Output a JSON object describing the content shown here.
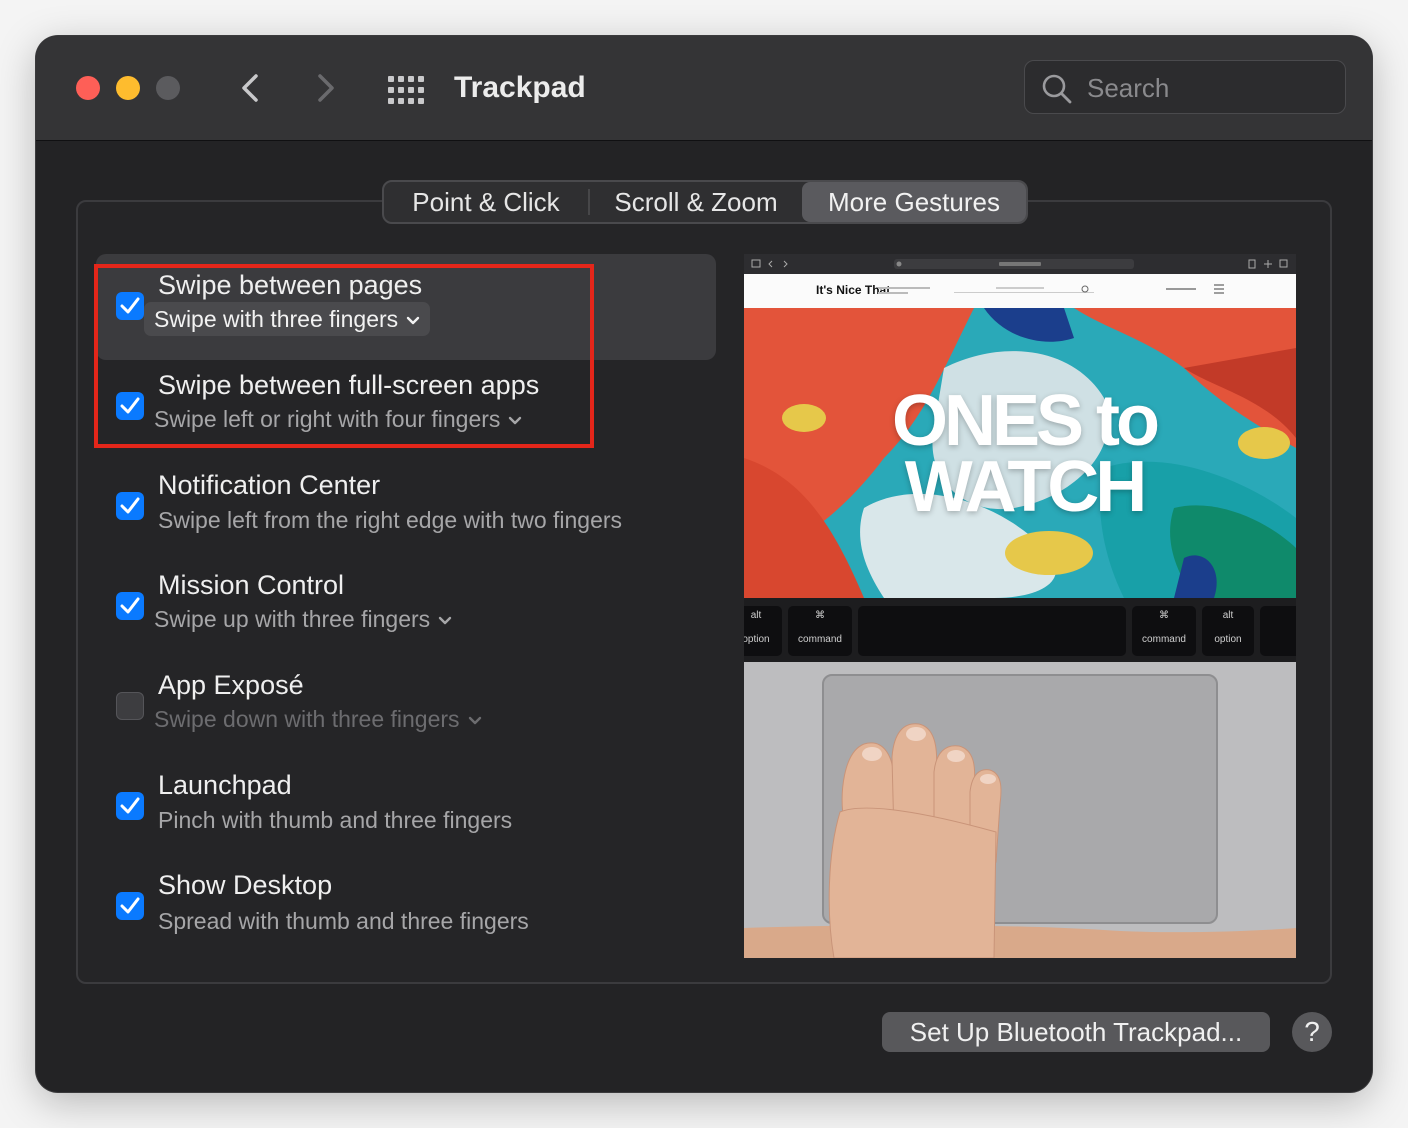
{
  "window": {
    "title": "Trackpad"
  },
  "search": {
    "placeholder": "Search"
  },
  "tabs": [
    {
      "label": "Point & Click",
      "selected": false
    },
    {
      "label": "Scroll & Zoom",
      "selected": false
    },
    {
      "label": "More Gestures",
      "selected": true
    }
  ],
  "gestures": [
    {
      "title": "Swipe between pages",
      "subtitle": "Swipe with three fingers",
      "checked": true,
      "has_dropdown": true
    },
    {
      "title": "Swipe between full-screen apps",
      "subtitle": "Swipe left or right with four fingers",
      "checked": true,
      "has_dropdown": true
    },
    {
      "title": "Notification Center",
      "subtitle": "Swipe left from the right edge with two fingers",
      "checked": true,
      "has_dropdown": false
    },
    {
      "title": "Mission Control",
      "subtitle": "Swipe up with three fingers",
      "checked": true,
      "has_dropdown": true
    },
    {
      "title": "App Exposé",
      "subtitle": "Swipe down with three fingers",
      "checked": false,
      "has_dropdown": true
    },
    {
      "title": "Launchpad",
      "subtitle": "Pinch with thumb and three fingers",
      "checked": true,
      "has_dropdown": false
    },
    {
      "title": "Show Desktop",
      "subtitle": "Spread with thumb and three fingers",
      "checked": true,
      "has_dropdown": false
    }
  ],
  "preview": {
    "site_name": "It's Nice That",
    "headline_line1": "ONES to",
    "headline_line2": "WATCH",
    "keys": {
      "alt": "alt",
      "option": "option",
      "cmd": "⌘",
      "command": "command"
    }
  },
  "footer": {
    "setup_button": "Set Up Bluetooth Trackpad...",
    "help_button": "?"
  },
  "colors": {
    "accent": "#0a7aff",
    "highlight": "#e4261a",
    "window_bg": "#232325"
  }
}
